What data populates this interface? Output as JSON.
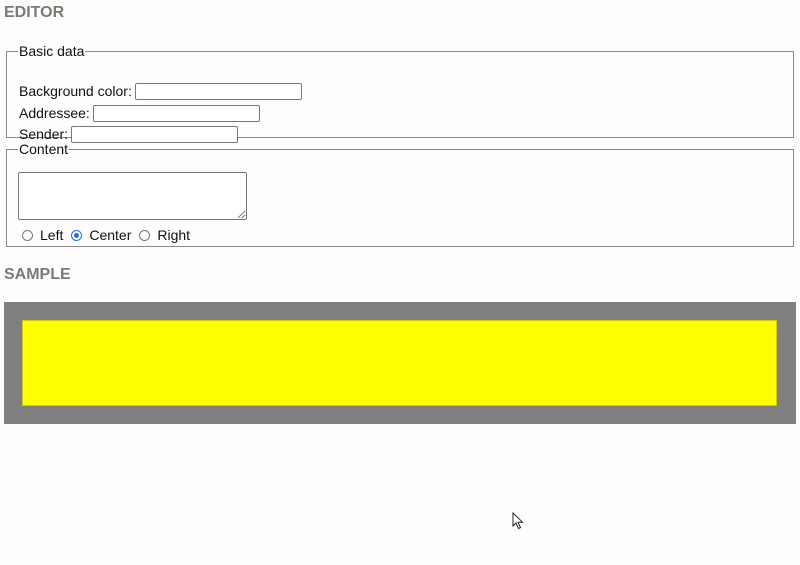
{
  "editor": {
    "heading": "EDITOR",
    "basic_data": {
      "legend": "Basic data",
      "background_color_label": "Background color:",
      "background_color_value": "",
      "addressee_label": "Addressee:",
      "addressee_value": "",
      "sender_label": "Sender:",
      "sender_value": ""
    },
    "content": {
      "legend": "Content",
      "text_value": "",
      "alignment_options": [
        "Left",
        "Center",
        "Right"
      ],
      "alignment_selected": "Center"
    }
  },
  "sample": {
    "heading": "SAMPLE",
    "frame_color": "#807f80",
    "card_color": "#ffff00"
  },
  "colors": {
    "heading": "#7b7b74",
    "radio_accent": "#1a73e8"
  },
  "icons": {
    "cursor": "arrow-pointer-icon"
  }
}
